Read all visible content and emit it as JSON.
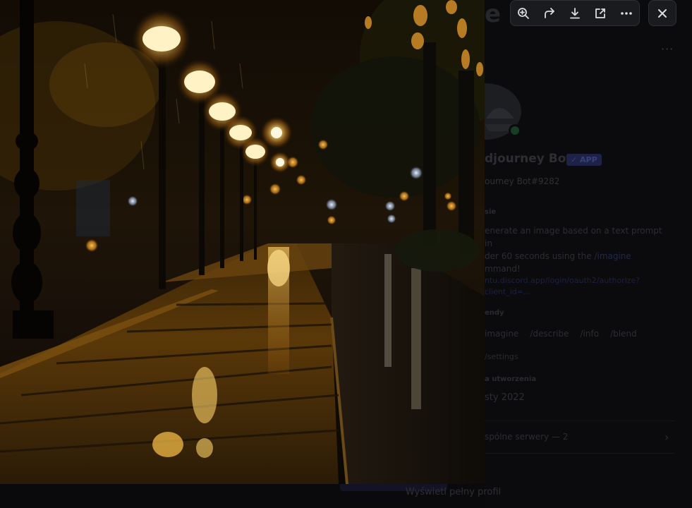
{
  "viewer": {
    "image_description": "Rainy night street with glowing streetlamps reflecting on wet pavement",
    "toolbar": {
      "zoom_icon": "zoom-in-icon",
      "forward_icon": "forward-icon",
      "download_icon": "download-icon",
      "open_icon": "open-external-icon",
      "more_icon": "more-icon"
    },
    "close_icon": "close-icon"
  },
  "profile": {
    "heading_partial": "e",
    "more_label": "···",
    "name": "djourney Bot",
    "app_badge": "✓ APP",
    "username": "ourney Bot#9282",
    "about_label": "sie",
    "about_text": "enerate an image based on a text prompt in",
    "about_text2": "der 60 seconds using the ",
    "about_cmd": "/imagine",
    "about_text3": "mmand!",
    "about_link": "ntu.discord.app/login/oauth2/authorize?client_id=...",
    "commands_label": "endy",
    "commands": [
      "imagine",
      "/describe",
      "/info",
      "/blend"
    ],
    "settings": "/settings",
    "created_label": "a utworzenia",
    "created_date": "sty 2022",
    "mutual_servers": "spólne serwery — 2",
    "chevron": "›",
    "full_profile": "Wyświetl pełny profil"
  },
  "colors": {
    "toolbar_bg": "#1a1b1e",
    "toolbar_border": "#2e3035",
    "icon": "#dbdee1",
    "lamp_glow": "#ffb545"
  }
}
